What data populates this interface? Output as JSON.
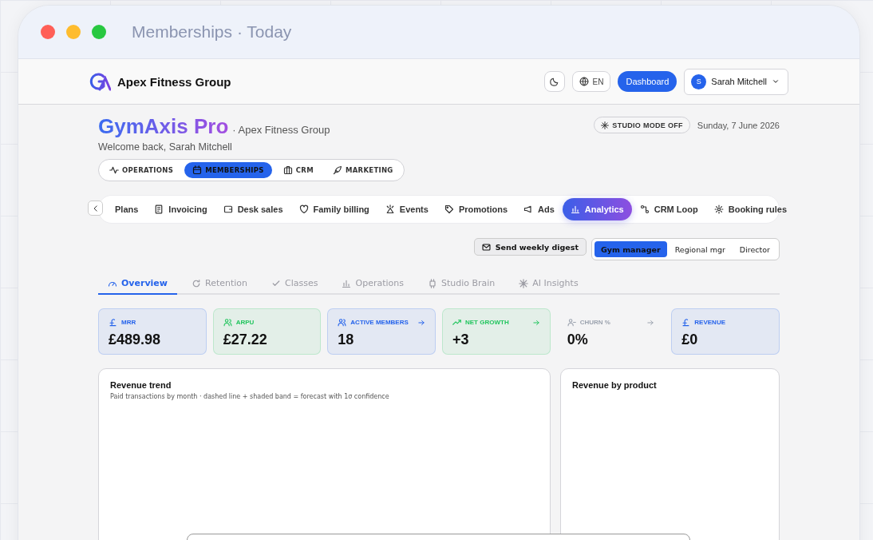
{
  "window": {
    "title": "Memberships · Today"
  },
  "header": {
    "brand": "Apex Fitness Group",
    "language": "EN",
    "dashboard_button": "Dashboard",
    "user": {
      "initial": "S",
      "name": "Sarah Mitchell"
    }
  },
  "hero": {
    "title": "GymAxis Pro",
    "org": "· Apex Fitness Group",
    "welcome": "Welcome back, Sarah Mitchell",
    "studio_mode": "STUDIO MODE OFF",
    "date": "Sunday, 7 June 2026"
  },
  "sections": [
    {
      "label": "OPERATIONS",
      "selected": false
    },
    {
      "label": "MEMBERSHIPS",
      "selected": true
    },
    {
      "label": "CRM",
      "selected": false
    },
    {
      "label": "MARKETING",
      "selected": false
    }
  ],
  "nav_tabs": [
    {
      "label": "Plans",
      "selected": false
    },
    {
      "label": "Invoicing",
      "selected": false
    },
    {
      "label": "Desk sales",
      "selected": false
    },
    {
      "label": "Family billing",
      "selected": false
    },
    {
      "label": "Events",
      "selected": false
    },
    {
      "label": "Promotions",
      "selected": false
    },
    {
      "label": "Ads",
      "selected": false
    },
    {
      "label": "Analytics",
      "selected": true
    },
    {
      "label": "CRM Loop",
      "selected": false
    },
    {
      "label": "Booking rules",
      "selected": false
    }
  ],
  "digest_button": "Send weekly digest",
  "roles": [
    {
      "label": "Gym manager",
      "selected": true
    },
    {
      "label": "Regional mgr",
      "selected": false
    },
    {
      "label": "Director",
      "selected": false
    }
  ],
  "sub_tabs": [
    {
      "label": "Overview",
      "selected": true
    },
    {
      "label": "Retention",
      "selected": false
    },
    {
      "label": "Classes",
      "selected": false
    },
    {
      "label": "Operations",
      "selected": false
    },
    {
      "label": "Studio Brain",
      "selected": false
    },
    {
      "label": "AI Insights",
      "selected": false
    }
  ],
  "kpis": [
    {
      "label": "MRR",
      "value": "£489.98",
      "color": "#2563eb",
      "link": false,
      "highlighted": true
    },
    {
      "label": "ARPU",
      "value": "£27.22",
      "color": "#22c55e",
      "link": false,
      "highlighted": true
    },
    {
      "label": "ACTIVE MEMBERS",
      "value": "18",
      "color": "#2563eb",
      "link": true,
      "highlighted": true
    },
    {
      "label": "NET GROWTH",
      "value": "+3",
      "color": "#22c55e",
      "link": true,
      "highlighted": true
    },
    {
      "label": "CHURN %",
      "value": "0%",
      "color": "#9ca3af",
      "link": true,
      "highlighted": false
    },
    {
      "label": "REVENUE",
      "value": "£0",
      "color": "#2563eb",
      "link": false,
      "highlighted": true
    }
  ],
  "panels": [
    {
      "title": "Revenue trend",
      "subtitle": "Paid transactions by month · dashed line + shaded band = forecast with 1σ confidence"
    },
    {
      "title": "Revenue by product"
    }
  ]
}
